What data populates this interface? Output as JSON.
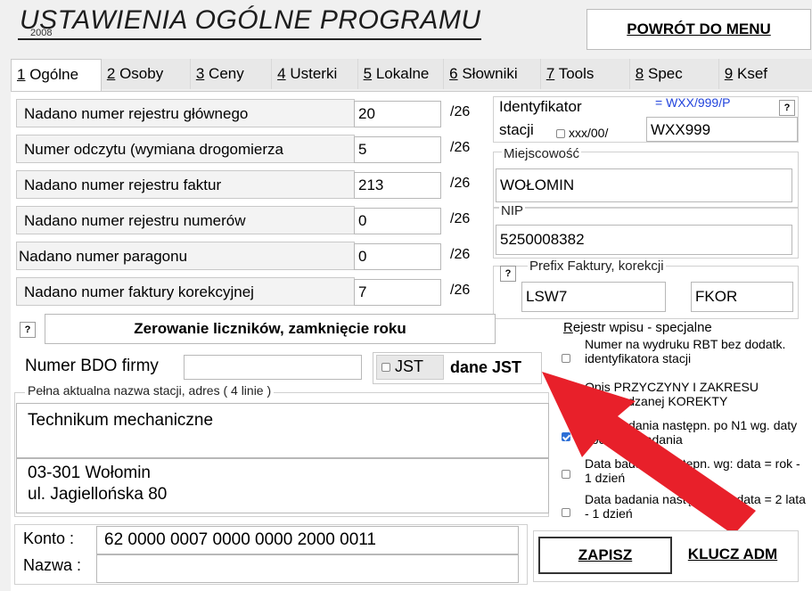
{
  "header": {
    "title": "USTAWIENIA OGÓLNE  PROGRAMU",
    "year": "2008",
    "menu_button": "POWRÓT DO MENU"
  },
  "tabs": [
    {
      "num": "1",
      "label": "Ogólne"
    },
    {
      "num": "2",
      "label": "Osoby"
    },
    {
      "num": "3",
      "label": "Ceny"
    },
    {
      "num": "4",
      "label": "Usterki"
    },
    {
      "num": "5",
      "label": "Lokalne"
    },
    {
      "num": "6",
      "label": "Słowniki"
    },
    {
      "num": "7",
      "label": "Tools"
    },
    {
      "num": "8",
      "label": "Spec"
    },
    {
      "num": "9",
      "label": "Ksef"
    }
  ],
  "counters": [
    {
      "label": "Nadano numer rejestru głównego",
      "value": "20",
      "suffix": "/26"
    },
    {
      "label": "Numer odczytu (wymiana drogomierza",
      "value": "5",
      "suffix": "/26"
    },
    {
      "label": "Nadano numer rejestru faktur",
      "value": "213",
      "suffix": "/26"
    },
    {
      "label": "Nadano numer rejestru numerów",
      "value": "0",
      "suffix": "/26"
    },
    {
      "label": "Nadano numer paragonu",
      "value": "0",
      "suffix": "/26"
    },
    {
      "label": "Nadano numer faktury korekcyjnej",
      "value": "7",
      "suffix": "/26"
    }
  ],
  "station": {
    "id_label_line1": "Identyfikator",
    "id_label_line2": "stacji",
    "format_option": "xxx/00/",
    "format_hint": "= WXX/999/P",
    "id_value": "WXX999",
    "city_label": "Miejscowość",
    "city_value": "WOŁOMIN",
    "nip_label": "NIP",
    "nip_value": "5250008382",
    "prefix_label": "Prefix Faktury,  korekcji",
    "prefix_invoice": "LSW7",
    "prefix_correction": "FKOR"
  },
  "reset_button": "Zerowanie liczników,  zamknięcie roku",
  "bdo": {
    "label": "Numer BDO firmy",
    "value": ""
  },
  "jst": {
    "checkbox_label": "JST",
    "button": "dane JST"
  },
  "address": {
    "label": "Pełna aktualna nazwa stacji, adres ( 4 linie )",
    "line1": "Technikum mechaniczne",
    "line2": "",
    "line3": "03-301 Wołomin",
    "line4": "ul. Jagiellońska 80"
  },
  "special": {
    "title_u": "R",
    "title_rest": "ejestr wpisu - specjalne",
    "items": [
      {
        "text": "Numer na wydruku RBT bez dodatk. identyfikatora stacji",
        "checked": false
      },
      {
        "text": "Opis PRZYCZYNY I ZAKRESU wprowadzanej KOREKTY",
        "checked": false
      },
      {
        "text": "Data badania następn. po N1 wg. daty początku badania",
        "checked": true
      },
      {
        "text": "Data badania następn. wg: data = rok - 1 dzień",
        "checked": false
      },
      {
        "text": "Data badania następn. wg: data = 2 lata - 1 dzień",
        "checked": false
      }
    ]
  },
  "account": {
    "konto_label": "Konto :",
    "konto_value": "62 0000 0007 0000 0000 2000 0011",
    "nazwa_label": "Nazwa :",
    "nazwa_value": ""
  },
  "buttons": {
    "save": "ZAPISZ",
    "admin_key": "KLUCZ ADM"
  },
  "help_mark": "?",
  "colors": {
    "accent": "#2d6fd6",
    "arrow": "#e8202a",
    "hint_text": "#2244dd"
  }
}
